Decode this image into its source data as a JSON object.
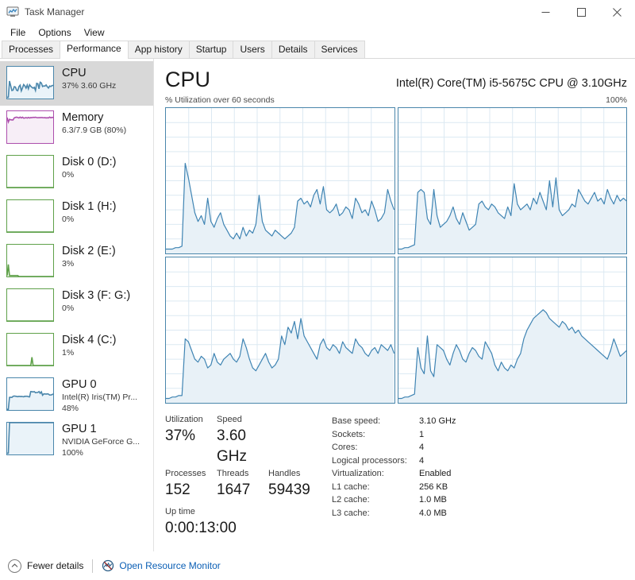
{
  "window": {
    "title": "Task Manager",
    "icon": "task-manager-icon",
    "buttons": {
      "minimize": "–",
      "maximize": "□",
      "close": "✕"
    }
  },
  "menu": {
    "items": [
      "File",
      "Options",
      "View"
    ]
  },
  "tabs": {
    "items": [
      {
        "label": "Processes",
        "selected": false
      },
      {
        "label": "Performance",
        "selected": true
      },
      {
        "label": "App history",
        "selected": false
      },
      {
        "label": "Startup",
        "selected": false
      },
      {
        "label": "Users",
        "selected": false
      },
      {
        "label": "Details",
        "selected": false
      },
      {
        "label": "Services",
        "selected": false
      }
    ]
  },
  "sidebar": {
    "items": [
      {
        "title": "CPU",
        "sub1": "37%  3.60 GHz",
        "sub2": "",
        "selected": true,
        "color": "#4a86ab",
        "fill": "#eaf3f9"
      },
      {
        "title": "Memory",
        "sub1": "6.3/7.9 GB (80%)",
        "sub2": "",
        "selected": false,
        "color": "#ad4fad",
        "fill": "#f7eef7"
      },
      {
        "title": "Disk 0 (D:)",
        "sub1": "0%",
        "sub2": "",
        "selected": false,
        "color": "#5fa14a",
        "fill": "#f0f7ec"
      },
      {
        "title": "Disk 1 (H:)",
        "sub1": "0%",
        "sub2": "",
        "selected": false,
        "color": "#5fa14a",
        "fill": "#f0f7ec"
      },
      {
        "title": "Disk 2 (E:)",
        "sub1": "3%",
        "sub2": "",
        "selected": false,
        "color": "#5fa14a",
        "fill": "#f0f7ec"
      },
      {
        "title": "Disk 3 (F: G:)",
        "sub1": "0%",
        "sub2": "",
        "selected": false,
        "color": "#5fa14a",
        "fill": "#f0f7ec"
      },
      {
        "title": "Disk 4 (C:)",
        "sub1": "1%",
        "sub2": "",
        "selected": false,
        "color": "#5fa14a",
        "fill": "#f0f7ec"
      },
      {
        "title": "GPU 0",
        "sub1": "Intel(R) Iris(TM) Pr...",
        "sub2": "48%",
        "selected": false,
        "color": "#4a86ab",
        "fill": "#eaf3f9"
      },
      {
        "title": "GPU 1",
        "sub1": "NVIDIA GeForce G...",
        "sub2": "100%",
        "selected": false,
        "color": "#4a86ab",
        "fill": "#eaf3f9"
      }
    ]
  },
  "main": {
    "title": "CPU",
    "model": "Intel(R) Core(TM) i5-5675C CPU @ 3.10GHz",
    "axis_label": "% Utilization over 60 seconds",
    "axis_max": "100%"
  },
  "stats": {
    "utilization_label": "Utilization",
    "utilization_value": "37%",
    "speed_label": "Speed",
    "speed_value": "3.60 GHz",
    "processes_label": "Processes",
    "processes_value": "152",
    "threads_label": "Threads",
    "threads_value": "1647",
    "handles_label": "Handles",
    "handles_value": "59439",
    "uptime_label": "Up time",
    "uptime_value": "0:00:13:00"
  },
  "specs": {
    "rows": [
      {
        "label": "Base speed:",
        "value": "3.10 GHz"
      },
      {
        "label": "Sockets:",
        "value": "1"
      },
      {
        "label": "Cores:",
        "value": "4"
      },
      {
        "label": "Logical processors:",
        "value": "4"
      },
      {
        "label": "Virtualization:",
        "value": "Enabled"
      },
      {
        "label": "L1 cache:",
        "value": "256 KB"
      },
      {
        "label": "L2 cache:",
        "value": "1.0 MB"
      },
      {
        "label": "L3 cache:",
        "value": "4.0 MB"
      }
    ]
  },
  "footer": {
    "fewer_details": "Fewer details",
    "resource_monitor": "Open Resource Monitor",
    "link_color": "#0b5fb5"
  },
  "chart_data": {
    "type": "line",
    "title": "CPU % Utilization over 60 seconds",
    "xlabel": "60 seconds",
    "ylabel": "% Utilization",
    "ylim": [
      0,
      100
    ],
    "grid": true,
    "legend": false,
    "line_color": "#3f84b3",
    "fill_color": "#e8f1f7",
    "grid_color": "#dce9f2",
    "panel_layout": "2x2 logical processors",
    "series": [
      {
        "name": "CPU 0",
        "values": [
          3,
          3,
          3,
          4,
          4,
          5,
          62,
          52,
          40,
          28,
          22,
          26,
          20,
          38,
          22,
          18,
          24,
          28,
          20,
          16,
          12,
          10,
          14,
          10,
          18,
          12,
          16,
          14,
          20,
          40,
          22,
          16,
          14,
          12,
          16,
          14,
          12,
          10,
          12,
          14,
          18,
          36,
          38,
          34,
          36,
          32,
          40,
          44,
          34,
          46,
          30,
          28,
          30,
          34,
          26,
          28,
          32,
          30,
          24,
          38,
          34,
          28,
          30,
          26,
          36,
          30,
          22,
          24,
          28,
          44,
          36,
          30
        ]
      },
      {
        "name": "CPU 1",
        "values": [
          3,
          3,
          4,
          4,
          5,
          6,
          42,
          44,
          42,
          24,
          20,
          44,
          26,
          18,
          20,
          22,
          26,
          32,
          24,
          20,
          28,
          22,
          16,
          18,
          20,
          34,
          36,
          32,
          30,
          34,
          32,
          28,
          26,
          24,
          32,
          26,
          48,
          34,
          30,
          32,
          34,
          30,
          38,
          34,
          42,
          36,
          30,
          50,
          32,
          52,
          30,
          26,
          28,
          30,
          34,
          32,
          44,
          40,
          36,
          34,
          38,
          42,
          36,
          38,
          34,
          44,
          38,
          34,
          40,
          36,
          38,
          36
        ]
      },
      {
        "name": "CPU 2",
        "values": [
          3,
          3,
          4,
          4,
          5,
          5,
          44,
          42,
          36,
          30,
          28,
          32,
          30,
          24,
          26,
          34,
          28,
          26,
          30,
          32,
          34,
          30,
          28,
          32,
          44,
          38,
          30,
          24,
          22,
          26,
          30,
          34,
          28,
          24,
          26,
          30,
          46,
          40,
          52,
          48,
          56,
          44,
          58,
          46,
          42,
          38,
          34,
          30,
          40,
          44,
          38,
          36,
          40,
          38,
          34,
          42,
          38,
          36,
          34,
          44,
          40,
          38,
          34,
          32,
          36,
          38,
          34,
          40,
          38,
          36,
          40,
          34
        ]
      },
      {
        "name": "CPU 3",
        "values": [
          3,
          3,
          4,
          4,
          5,
          6,
          38,
          24,
          20,
          46,
          22,
          18,
          40,
          38,
          36,
          30,
          26,
          34,
          40,
          36,
          30,
          28,
          34,
          38,
          36,
          32,
          30,
          42,
          38,
          34,
          26,
          22,
          28,
          24,
          22,
          26,
          24,
          30,
          34,
          44,
          50,
          54,
          58,
          60,
          62,
          64,
          62,
          58,
          56,
          54,
          52,
          56,
          54,
          50,
          52,
          48,
          50,
          46,
          44,
          42,
          40,
          38,
          36,
          34,
          32,
          30,
          36,
          44,
          38,
          32,
          34,
          36
        ]
      }
    ]
  }
}
